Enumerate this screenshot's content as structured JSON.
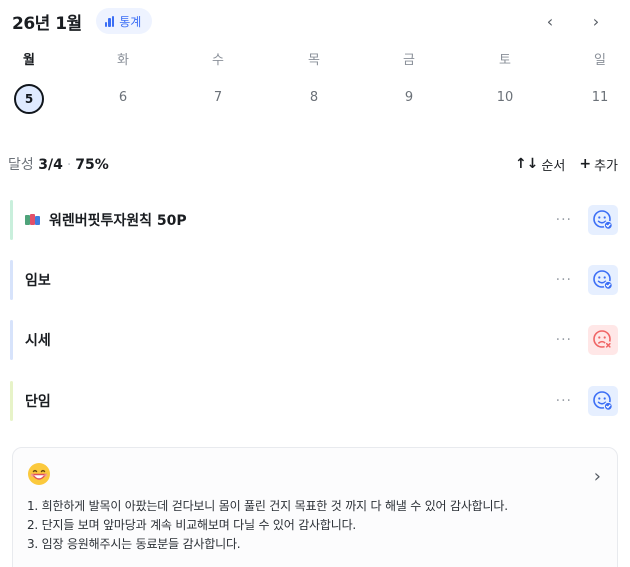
{
  "header": {
    "month_title": "26년 1월",
    "stats_label": "통계",
    "prev_icon": "‹",
    "next_icon": "›"
  },
  "week": {
    "days": [
      {
        "dow": "월",
        "date": "5",
        "selected": true
      },
      {
        "dow": "화",
        "date": "6"
      },
      {
        "dow": "수",
        "date": "7"
      },
      {
        "dow": "목",
        "date": "8"
      },
      {
        "dow": "금",
        "date": "9"
      },
      {
        "dow": "토",
        "date": "10"
      },
      {
        "dow": "일",
        "date": "11"
      }
    ]
  },
  "summary": {
    "label": "달성",
    "fraction": "3/4",
    "separator": "·",
    "percent": "75%",
    "sort_icon": "↑↓",
    "sort_label": "순서",
    "add_icon": "+",
    "add_label": "추가"
  },
  "tasks": [
    {
      "name": "워렌버핏투자원칙 50P",
      "color": "#c9efdc",
      "mood": "good",
      "more": "···"
    },
    {
      "name": "임보",
      "color": "#d7e3fb",
      "mood": "good",
      "more": "···"
    },
    {
      "name": "시세",
      "color": "#d7e3fb",
      "mood": "bad",
      "more": "···"
    },
    {
      "name": "단임",
      "color": "#e7f3c8",
      "mood": "good",
      "more": "···"
    }
  ],
  "colors": {
    "accent": "#3b6ef5",
    "good_bg": "#e6efff",
    "bad": "#f06464",
    "bad_bg": "#ffe7e7"
  },
  "gratitude": {
    "emoji": "grinning-face-icon",
    "lines": [
      "1. 희한하게 발목이 아팠는데 걷다보니 몸이 풀린 건지 목표한 것 까지 다 해낼 수 있어 감사합니다.",
      "2. 단지들 보며 앞마당과 계속 비교해보며 다닐 수 있어 감사합니다.",
      "3. 임장 응원해주시는 동료분들 감사합니다."
    ]
  }
}
